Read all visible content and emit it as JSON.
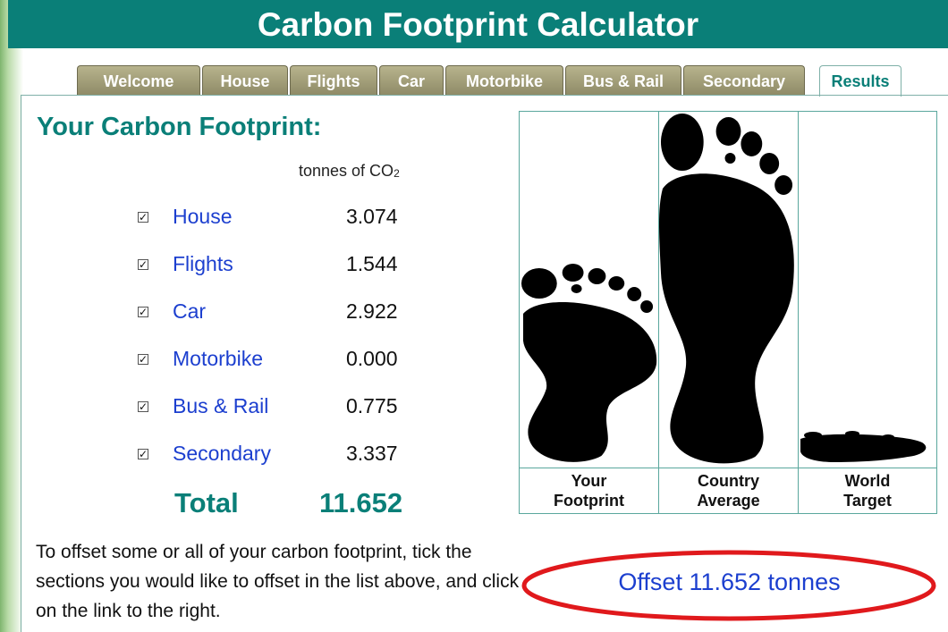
{
  "title": "Carbon Footprint Calculator",
  "tabs": [
    {
      "label": "Welcome"
    },
    {
      "label": "House"
    },
    {
      "label": "Flights"
    },
    {
      "label": "Car"
    },
    {
      "label": "Motorbike"
    },
    {
      "label": "Bus & Rail"
    },
    {
      "label": "Secondary"
    },
    {
      "label": "Results",
      "active": true
    }
  ],
  "results": {
    "heading": "Your Carbon Footprint:",
    "units": "tonnes of CO",
    "units_sub": "2",
    "rows": [
      {
        "label": "House",
        "value": "3.074",
        "checked": true
      },
      {
        "label": "Flights",
        "value": "1.544",
        "checked": true
      },
      {
        "label": "Car",
        "value": "2.922",
        "checked": true
      },
      {
        "label": "Motorbike",
        "value": "0.000",
        "checked": true
      },
      {
        "label": "Bus & Rail",
        "value": "0.775",
        "checked": true
      },
      {
        "label": "Secondary",
        "value": "3.337",
        "checked": true
      }
    ],
    "total_label": "Total",
    "total_value": "11.652"
  },
  "instructions": "To offset some or all of your carbon footprint, tick the sections you would like to offset in the list above, and click on the link to the right.",
  "comparison": [
    {
      "label_line1": "Your",
      "label_line2": "Footprint",
      "icon": "footprint-icon"
    },
    {
      "label_line1": "Country",
      "label_line2": "Average",
      "icon": "footprint-icon"
    },
    {
      "label_line1": "World",
      "label_line2": "Target",
      "icon": "footprint-icon"
    }
  ],
  "offset_link": "Offset 11.652 tonnes",
  "colors": {
    "brand": "#0a7f78",
    "tab": "#a09c77",
    "link": "#1c3fcf",
    "highlight_ring": "#e0191c"
  }
}
